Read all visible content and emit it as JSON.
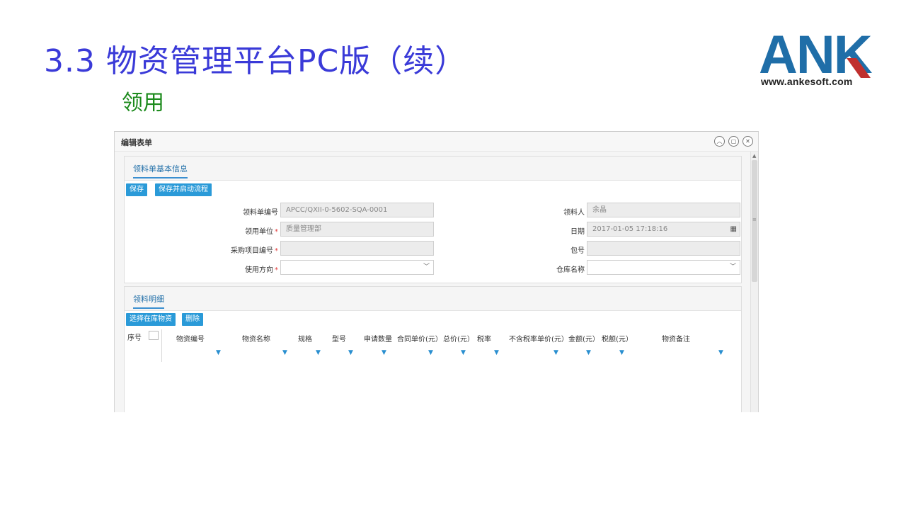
{
  "slide": {
    "title": "3.3 物资管理平台PC版（续）",
    "subtitle": "领用",
    "logo_letters": "ANK",
    "logo_url": "www.ankesoft.com"
  },
  "window": {
    "title": "编辑表单",
    "controls": [
      "collapse-icon",
      "restore-icon",
      "close-icon"
    ]
  },
  "basic_info": {
    "tab_label": "领料单基本信息",
    "buttons": {
      "save": "保存",
      "save_start": "保存并启动流程"
    },
    "fields": {
      "order_no": {
        "label": "领料单编号",
        "value": "APCC/QXII-0-5602-SQA-0001"
      },
      "recipient": {
        "label": "领料人",
        "value": "余晶"
      },
      "dept": {
        "label": "领用单位",
        "value": "质量管理部"
      },
      "date": {
        "label": "日期",
        "value": "2017-01-05 17:18:16"
      },
      "project_no": {
        "label": "采购项目编号",
        "value": ""
      },
      "package_no": {
        "label": "包号",
        "value": ""
      },
      "usage": {
        "label": "使用方向",
        "value": ""
      },
      "warehouse": {
        "label": "仓库名称",
        "value": ""
      }
    },
    "required_mark": "*"
  },
  "details": {
    "tab_label": "领料明细",
    "buttons": {
      "select_stock": "选择在库物资",
      "delete": "删除"
    },
    "columns": [
      "序号",
      "物资编号",
      "物资名称",
      "规格",
      "型号",
      "申请数量",
      "合同单价(元）",
      "总价(元）",
      "税率",
      "不含税率单价(元）",
      "金额(元）",
      "税额(元）",
      "物资备注"
    ],
    "rows": []
  },
  "colors": {
    "title": "#3a3ad8",
    "subtitle": "#1c8a1c",
    "button": "#2a9ad8",
    "logo_blue": "#1f6ea8",
    "logo_red": "#c0302e",
    "filter": "#2a8fd0"
  }
}
